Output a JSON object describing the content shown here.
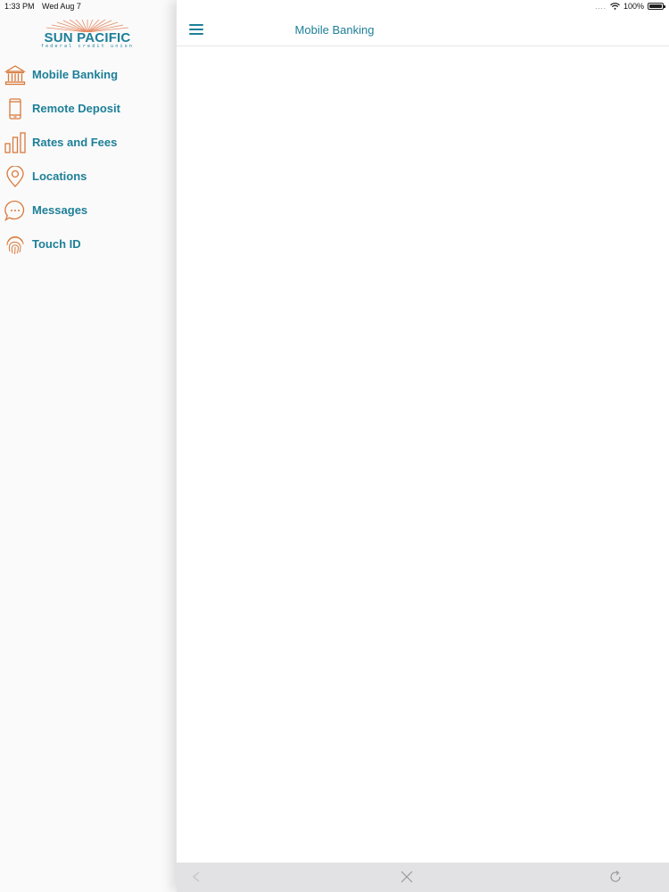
{
  "status_bar": {
    "time": "1:33 PM",
    "date": "Wed Aug 7",
    "battery_percent": "100%",
    "signal_dots": "....",
    "wifi_icon": "wifi-icon",
    "battery_icon": "battery-icon"
  },
  "logo": {
    "name": "SUN PACIFIC",
    "tagline": "federal credit union"
  },
  "sidebar": {
    "items": [
      {
        "label": "Mobile Banking",
        "icon": "bank-icon"
      },
      {
        "label": "Remote Deposit",
        "icon": "phone-icon"
      },
      {
        "label": "Rates and Fees",
        "icon": "bar-chart-icon"
      },
      {
        "label": "Locations",
        "icon": "location-pin-icon"
      },
      {
        "label": "Messages",
        "icon": "chat-bubble-icon"
      },
      {
        "label": "Touch ID",
        "icon": "fingerprint-icon"
      }
    ]
  },
  "header": {
    "title": "Mobile Banking",
    "menu_icon": "hamburger-menu-icon"
  },
  "bottom_bar": {
    "back_icon": "back-arrow-icon",
    "close_icon": "close-icon",
    "refresh_icon": "refresh-icon"
  },
  "colors": {
    "brand_teal": "#1d7f98",
    "icon_orange": "#d97a3c",
    "sunburst": "#e48c66"
  }
}
